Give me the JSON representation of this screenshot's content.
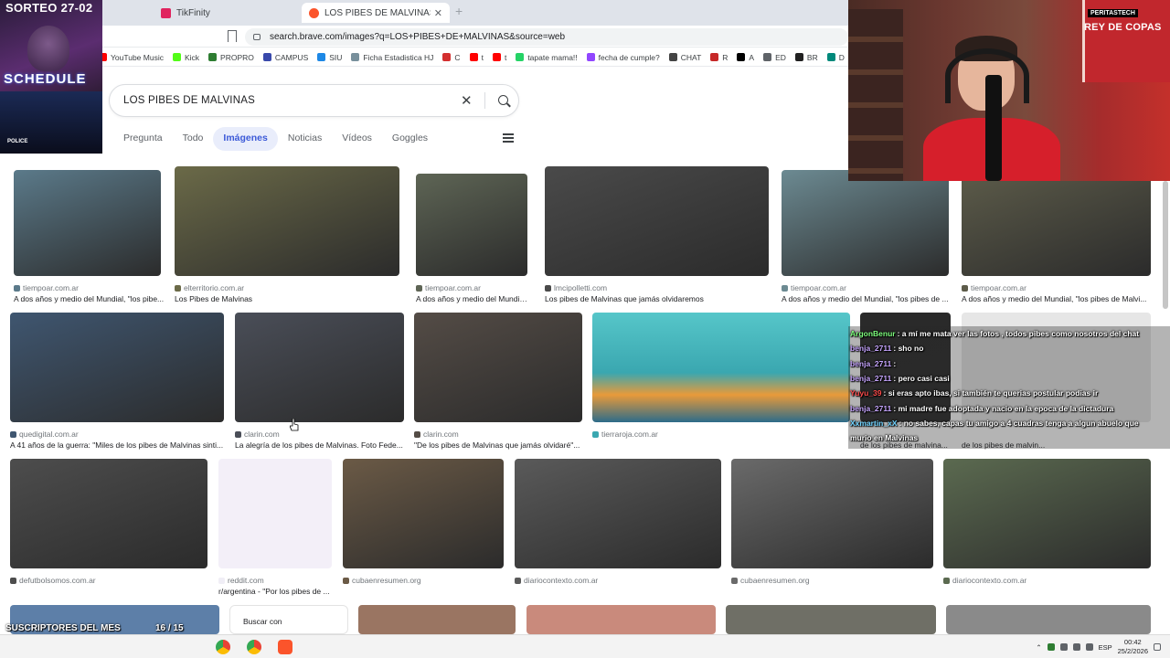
{
  "browser": {
    "tabs": [
      {
        "label": "TikFinity",
        "active": false
      },
      {
        "label": "LOS PIBES DE MALVINAS - Brave",
        "active": true
      }
    ],
    "url": "search.brave.com/images?q=LOS+PIBES+DE+MALVINAS&source=web",
    "bookmarks": [
      {
        "label": "YouTube Music",
        "icon": "youtube-music-icon",
        "color": "#ff0000"
      },
      {
        "label": "Kick",
        "icon": "kick-icon",
        "color": "#53fc18"
      },
      {
        "label": "PROPRO",
        "icon": "globe-icon",
        "color": "#2e7d32"
      },
      {
        "label": "CAMPUS",
        "icon": "campus-icon",
        "color": "#3949ab"
      },
      {
        "label": "SIU",
        "icon": "siu-icon",
        "color": "#1e88e5"
      },
      {
        "label": "Ficha Estadistica HJ",
        "icon": "document-icon",
        "color": "#78909c"
      },
      {
        "label": "C",
        "icon": "c-icon",
        "color": "#d32f2f"
      },
      {
        "label": "t",
        "icon": "youtube-icon",
        "color": "#ff0000"
      },
      {
        "label": "t",
        "icon": "youtube-icon",
        "color": "#ff0000"
      },
      {
        "label": "tapate mama!!",
        "icon": "whatsapp-icon",
        "color": "#25d366"
      },
      {
        "label": "fecha de cumple?",
        "icon": "twitch-icon",
        "color": "#9146ff"
      },
      {
        "label": "CHAT",
        "icon": "chat-icon",
        "color": "#444444"
      },
      {
        "label": "R",
        "icon": "r-icon",
        "color": "#c62828"
      },
      {
        "label": "A",
        "icon": "x-icon",
        "color": "#000000"
      },
      {
        "label": "ED",
        "icon": "folder-icon",
        "color": "#5f6368"
      },
      {
        "label": "BR",
        "icon": "br-icon",
        "color": "#212121"
      },
      {
        "label": "D",
        "icon": "d-icon",
        "color": "#00897b"
      }
    ]
  },
  "search": {
    "query": "LOS PIBES DE MALVINAS",
    "tabs": [
      "Pregunta",
      "Todo",
      "Imágenes",
      "Noticias",
      "Vídeos",
      "Goggles"
    ],
    "active_tab": "Imágenes",
    "results": [
      {
        "source": "tiempoar.com.ar",
        "title": "A dos años y medio del Mundial, \"los pibe...",
        "color": "#5b7a8a"
      },
      {
        "source": "elterritorio.com.ar",
        "title": "Los Pibes de Malvinas",
        "color": "#6b6a48"
      },
      {
        "source": "tiempoar.com.ar",
        "title": "A dos años y medio del Mundial, ...",
        "color": "#5e6555"
      },
      {
        "source": "lmcipolletti.com",
        "title": "Los pibes de Malvinas que jamás olvidaremos",
        "color": "#4a4a4a"
      },
      {
        "source": "tiempoar.com.ar",
        "title": "A dos años y medio del Mundial, \"los pibes de ...",
        "color": "#6c8a92"
      },
      {
        "source": "tiempoar.com.ar",
        "title": "A dos años y medio del Mundial, \"los pibes de Malvi...",
        "color": "#5d5c4a"
      },
      {
        "source": "quedigital.com.ar",
        "title": "A 41 años de la guerra: \"Miles de los pibes de Malvinas sinti...",
        "color": "#3f5670"
      },
      {
        "source": "clarin.com",
        "title": "La alegría de los pibes de Malvinas. Foto Fede...",
        "color": "#4a4e58"
      },
      {
        "source": "clarin.com",
        "title": "\"De los pibes de Malvinas que jamás olvidaré\"...",
        "color": "#544c46"
      },
      {
        "source": "tierraroja.com.ar",
        "title": "",
        "color": "#3aa7b0"
      },
      {
        "source": "",
        "title": "de los pibes de malvina...",
        "color": "#2a2a2a"
      },
      {
        "source": "",
        "title": "de los pibes de malvin...",
        "color": "#e6e6e6"
      },
      {
        "source": "defutbolsomos.com.ar",
        "title": "",
        "color": "#4d4d4d"
      },
      {
        "source": "reddit.com",
        "title": "r/argentina - \"Por los pibes de ...",
        "color": "#f0eef6"
      },
      {
        "source": "cubaenresumen.org",
        "title": "",
        "color": "#6b5a46"
      },
      {
        "source": "diariocontexto.com.ar",
        "title": "",
        "color": "#5a5a5a"
      },
      {
        "source": "cubaenresumen.org",
        "title": "",
        "color": "#6a6a6a"
      },
      {
        "source": "diariocontexto.com.ar",
        "title": "",
        "color": "#5b6a50"
      }
    ],
    "buscar_con_label": "Buscar con"
  },
  "overlay": {
    "promo_title": "SORTEO 27-02",
    "promo_schedule": "SCHEDULE",
    "promo_police": "POLICE",
    "webcam_banner_top": "PERITASTECH",
    "webcam_banner_text": "REY DE COPAS",
    "subs_label": "SUSCRIPTORES DEL MES",
    "subs_count": "16 / 15",
    "chat": [
      {
        "user": "ArgonBenur",
        "user_color": "#7fff7f",
        "message": ": a mí me mata ver las fotos , todos pibes como nosotros del chat"
      },
      {
        "user": "benja_2711",
        "user_color": "#c7a6ff",
        "message": ": sho no"
      },
      {
        "user": "benja_2711",
        "user_color": "#c7a6ff",
        "message": ":"
      },
      {
        "user": "benja_2711",
        "user_color": "#c7a6ff",
        "message": ": pero casi casi"
      },
      {
        "user": "Yuyu_39",
        "user_color": "#ff4d4d",
        "message": ": si eras apto ibas, si también te querias postular podias ir"
      },
      {
        "user": "benja_2711",
        "user_color": "#c7a6ff",
        "message": ": mi madre fue adoptada y nacio en la epoca de la dictadura"
      },
      {
        "user": "Xxmartin_xX",
        "user_color": "#6fd3ff",
        "message": ": no sabes, capas tu amigo a 4 cuadras tenga a algun abuelo que"
      },
      {
        "user": "",
        "user_color": "#ffffff",
        "message": "murio en Malvinas"
      }
    ]
  },
  "taskbar": {
    "lang": "ESP",
    "time": "00:42",
    "date": "25/2/2026"
  }
}
